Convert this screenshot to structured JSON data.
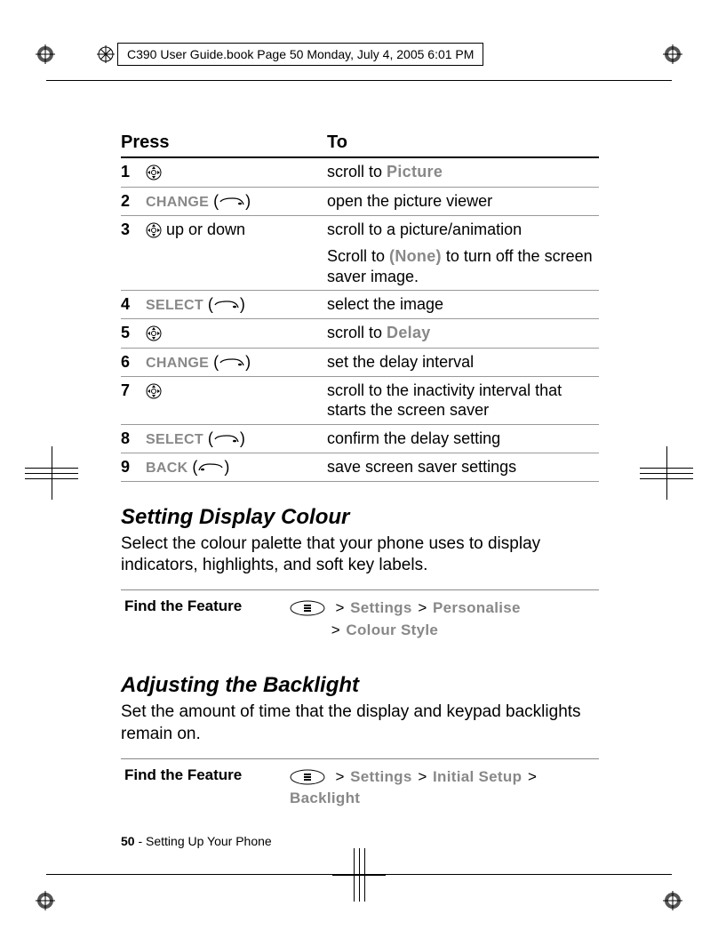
{
  "header_text": "C390 User Guide.book  Page 50  Monday, July 4, 2005  6:01 PM",
  "table": {
    "press_header": "Press",
    "to_header": "To",
    "rows": [
      {
        "num": "1",
        "press_soft": "",
        "press_extra": "",
        "to": "scroll to ",
        "to_menu": "Picture",
        "has_nav": true,
        "has_softkey": false,
        "softkey_dir": ""
      },
      {
        "num": "2",
        "press_soft": "CHANGE",
        "press_extra": "",
        "to": "open the picture viewer",
        "to_menu": "",
        "has_nav": false,
        "has_softkey": true,
        "softkey_dir": "right"
      },
      {
        "num": "3",
        "press_soft": "",
        "press_extra": " up or down",
        "to": "scroll to a picture/animation",
        "to_extra": "Scroll to ",
        "to_extra_menu": "(None)",
        "to_extra2": " to turn off the screen saver image.",
        "has_nav": true,
        "has_softkey": false,
        "softkey_dir": ""
      },
      {
        "num": "4",
        "press_soft": "SELECT",
        "press_extra": "",
        "to": "select the image",
        "to_menu": "",
        "has_nav": false,
        "has_softkey": true,
        "softkey_dir": "right"
      },
      {
        "num": "5",
        "press_soft": "",
        "press_extra": "",
        "to": "scroll to ",
        "to_menu": "Delay",
        "has_nav": true,
        "has_softkey": false,
        "softkey_dir": ""
      },
      {
        "num": "6",
        "press_soft": "CHANGE",
        "press_extra": "",
        "to": "set the delay interval",
        "to_menu": "",
        "has_nav": false,
        "has_softkey": true,
        "softkey_dir": "right"
      },
      {
        "num": "7",
        "press_soft": "",
        "press_extra": "",
        "to": "scroll to the inactivity interval that starts the screen saver",
        "to_menu": "",
        "has_nav": true,
        "has_softkey": false,
        "softkey_dir": ""
      },
      {
        "num": "8",
        "press_soft": "SELECT",
        "press_extra": "",
        "to": "confirm the delay setting",
        "to_menu": "",
        "has_nav": false,
        "has_softkey": true,
        "softkey_dir": "right"
      },
      {
        "num": "9",
        "press_soft": "BACK",
        "press_extra": "",
        "to": "save screen saver settings",
        "to_menu": "",
        "has_nav": false,
        "has_softkey": true,
        "softkey_dir": "left"
      }
    ]
  },
  "section1": {
    "heading": "Setting Display Colour",
    "body": "Select the colour palette that your phone uses to display indicators, highlights, and soft key labels.",
    "find_label": "Find the Feature",
    "path": [
      "Settings",
      "Personalise",
      "Colour Style"
    ]
  },
  "section2": {
    "heading": "Adjusting the Backlight",
    "body": "Set the amount of time that the display and keypad backlights remain on.",
    "find_label": "Find the Feature",
    "path": [
      "Settings",
      "Initial Setup",
      "Backlight"
    ]
  },
  "footer": {
    "page_num": "50",
    "section": " - Setting Up Your Phone"
  }
}
